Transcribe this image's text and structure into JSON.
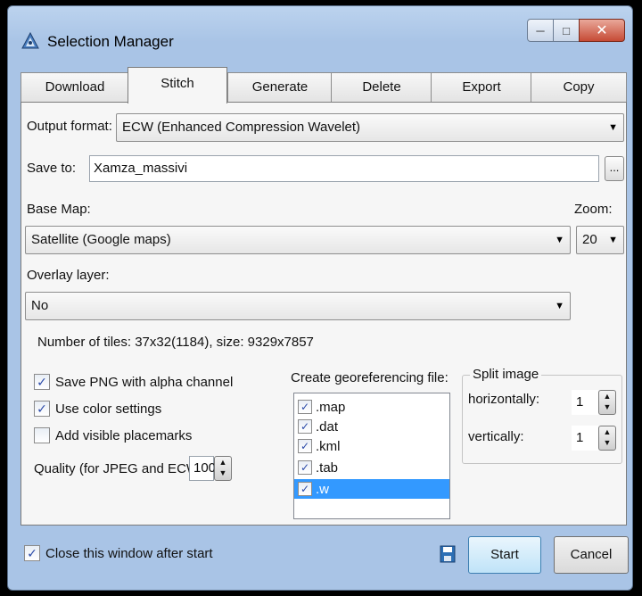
{
  "window": {
    "title": "Selection Manager"
  },
  "tabs": [
    {
      "label": "Download"
    },
    {
      "label": "Stitch",
      "active": true
    },
    {
      "label": "Generate"
    },
    {
      "label": "Delete"
    },
    {
      "label": "Export"
    },
    {
      "label": "Copy"
    }
  ],
  "output_format": {
    "label": "Output format:",
    "value": "ECW (Enhanced Compression Wavelet)"
  },
  "save_to": {
    "label": "Save to:",
    "value": "Xamza_massivi",
    "browse_label": "..."
  },
  "base_map": {
    "label": "Base Map:",
    "value": "Satellite (Google maps)"
  },
  "zoom": {
    "label": "Zoom:",
    "value": "20"
  },
  "overlay": {
    "label": "Overlay layer:",
    "value": "No"
  },
  "tiles_info": "Number of tiles: 37x32(1184), size: 9329x7857",
  "options": [
    {
      "label": "Save PNG with alpha channel",
      "checked": true
    },
    {
      "label": "Use color settings",
      "checked": true
    },
    {
      "label": "Add visible placemarks",
      "checked": false
    }
  ],
  "quality": {
    "label": "Quality (for JPEG and ECW):",
    "value": "100"
  },
  "georef": {
    "label": "Create georeferencing file:",
    "items": [
      {
        "label": ".map",
        "checked": true
      },
      {
        "label": ".dat",
        "checked": true
      },
      {
        "label": ".kml",
        "checked": true
      },
      {
        "label": ".tab",
        "checked": true
      },
      {
        "label": ".w",
        "checked": true,
        "selected": true
      }
    ]
  },
  "split": {
    "title": "Split image",
    "horizontal_label": "horizontally:",
    "horizontal_value": "1",
    "vertical_label": "vertically:",
    "vertical_value": "1"
  },
  "footer": {
    "close_after_start_label": "Close this window after start",
    "close_after_start_checked": true,
    "start_label": "Start",
    "cancel_label": "Cancel"
  },
  "icons": {
    "app": "app-icon",
    "minimize": "minimize-icon",
    "maximize": "maximize-icon",
    "close": "close-icon",
    "save": "save-icon",
    "check": "check-icon"
  },
  "colors": {
    "selection": "#3399ff",
    "close_button": "#c64a35",
    "title_bg": "#a9c4e6"
  }
}
